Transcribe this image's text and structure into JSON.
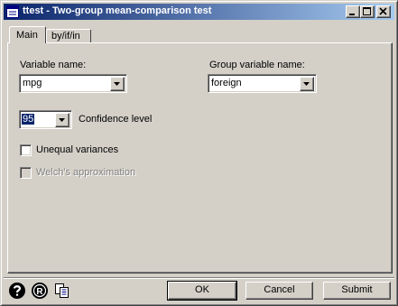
{
  "window": {
    "title": "ttest - Two-group mean-comparison test",
    "icons": {
      "app": "dialog-app-icon",
      "minimize": "minimize-icon",
      "maximize": "maximize-icon",
      "close": "close-icon"
    }
  },
  "tabs": [
    {
      "label": "Main",
      "active": true
    },
    {
      "label": "by/if/in",
      "active": false
    }
  ],
  "main": {
    "variable": {
      "label": "Variable name:",
      "value": "mpg"
    },
    "group_variable": {
      "label": "Group variable name:",
      "value": "foreign"
    },
    "confidence": {
      "value": "95",
      "label": "Confidence level"
    },
    "unequal": {
      "label": "Unequal variances",
      "checked": false
    },
    "welch": {
      "label": "Welch's approximation",
      "checked": false,
      "enabled": false
    }
  },
  "footer": {
    "icons": [
      "help-icon",
      "reset-icon",
      "copy-command-icon"
    ],
    "ok_label": "OK",
    "cancel_label": "Cancel",
    "submit_label": "Submit"
  }
}
